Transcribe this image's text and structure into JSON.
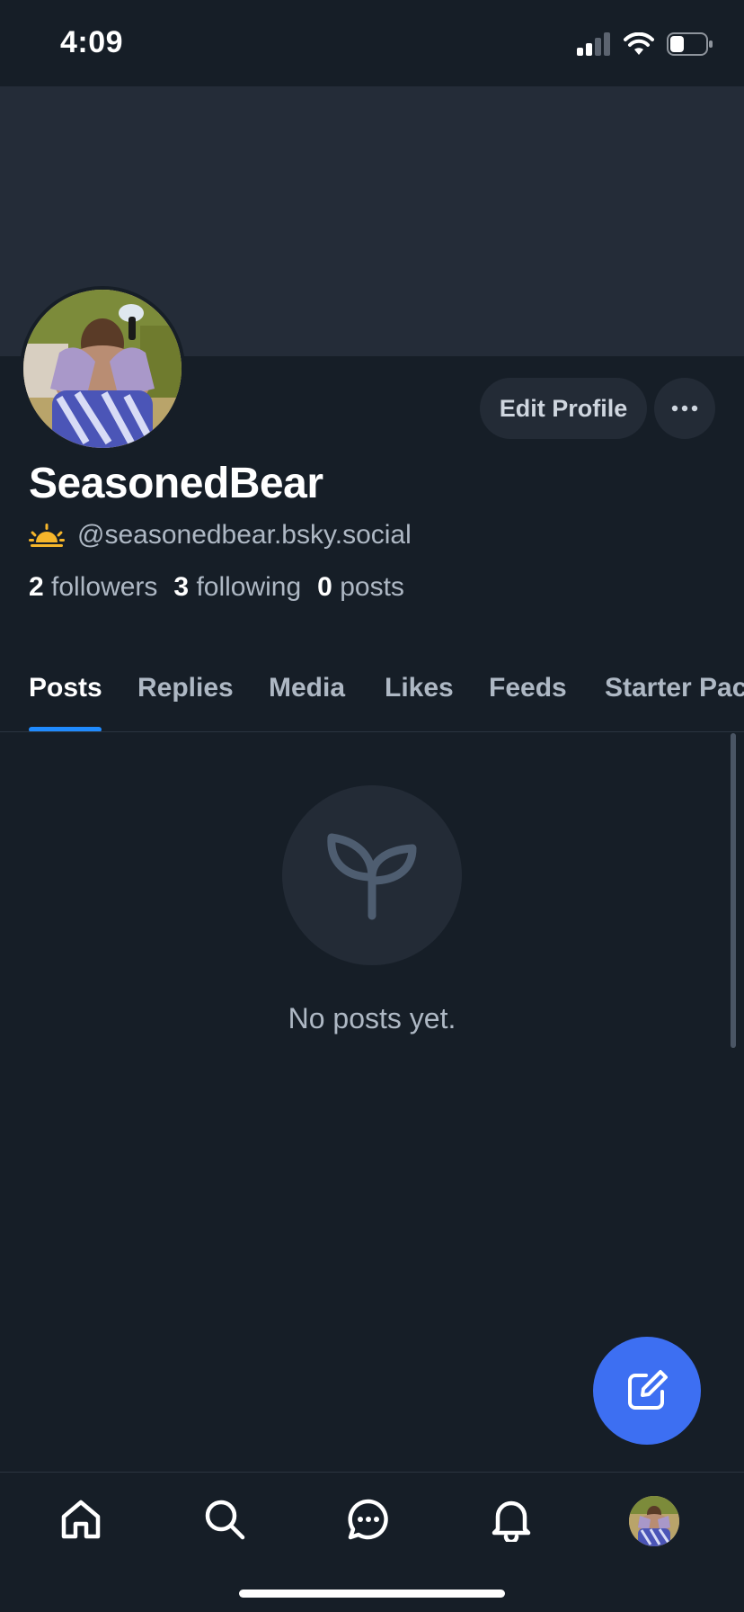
{
  "status_bar": {
    "time": "4:09"
  },
  "profile": {
    "display_name": "SeasonedBear",
    "handle": "@seasonedbear.bsky.social",
    "edit_button_label": "Edit Profile",
    "stats": {
      "followers_count": "2",
      "followers_label": "followers",
      "following_count": "3",
      "following_label": "following",
      "posts_count": "0",
      "posts_label": "posts"
    }
  },
  "tabs": [
    "Posts",
    "Replies",
    "Media",
    "Likes",
    "Feeds",
    "Starter Packs"
  ],
  "active_tab": "Posts",
  "empty_state": {
    "message": "No posts yet.",
    "icon": "sprout-icon"
  },
  "bottom_nav": [
    "home-icon",
    "search-icon",
    "chat-icon",
    "bell-icon",
    "profile-avatar"
  ],
  "colors": {
    "background": "#161e27",
    "banner": "#242c38",
    "button_bg": "#232b36",
    "accent": "#208bfe",
    "fab": "#3d6ff2",
    "secondary_text": "#aeb8c4"
  }
}
